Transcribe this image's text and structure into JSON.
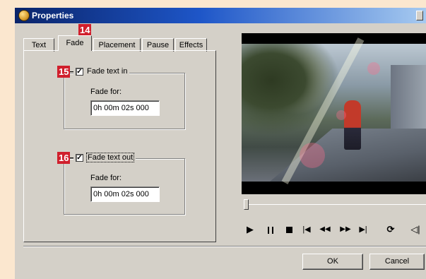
{
  "window": {
    "title": "Properties",
    "accent_color": "#0a246a",
    "face_color": "#d4d0c8"
  },
  "tabs": [
    {
      "label": "Text",
      "active": false
    },
    {
      "label": "Fade",
      "active": true
    },
    {
      "label": "Placement",
      "active": false
    },
    {
      "label": "Pause",
      "active": false
    },
    {
      "label": "Effects",
      "active": false
    }
  ],
  "fade_in": {
    "label": "Fade text in",
    "checked": true,
    "fade_for_label": "Fade for:",
    "value": "0h 00m 02s 000"
  },
  "fade_out": {
    "label": "Fade text out",
    "checked": true,
    "fade_for_label": "Fade for:",
    "value": "0h 00m 02s 000"
  },
  "callouts": {
    "tab": "14",
    "fade_in": "15",
    "fade_out": "16",
    "color": "#d01f2c"
  },
  "player": {
    "seek_position": 0,
    "controls": [
      {
        "name": "play",
        "glyph": "▶"
      },
      {
        "name": "pause",
        "glyph": "❚❚"
      },
      {
        "name": "stop",
        "glyph": "■"
      },
      {
        "name": "go-to-start",
        "glyph": "|◀"
      },
      {
        "name": "rewind",
        "glyph": "◀◀"
      },
      {
        "name": "fast-forward",
        "glyph": "▶▶"
      },
      {
        "name": "go-to-end",
        "glyph": "▶|"
      },
      {
        "name": "loop",
        "glyph": "⟳"
      },
      {
        "name": "volume",
        "glyph": "🔈"
      }
    ]
  },
  "buttons": {
    "ok": "OK",
    "cancel": "Cancel"
  }
}
